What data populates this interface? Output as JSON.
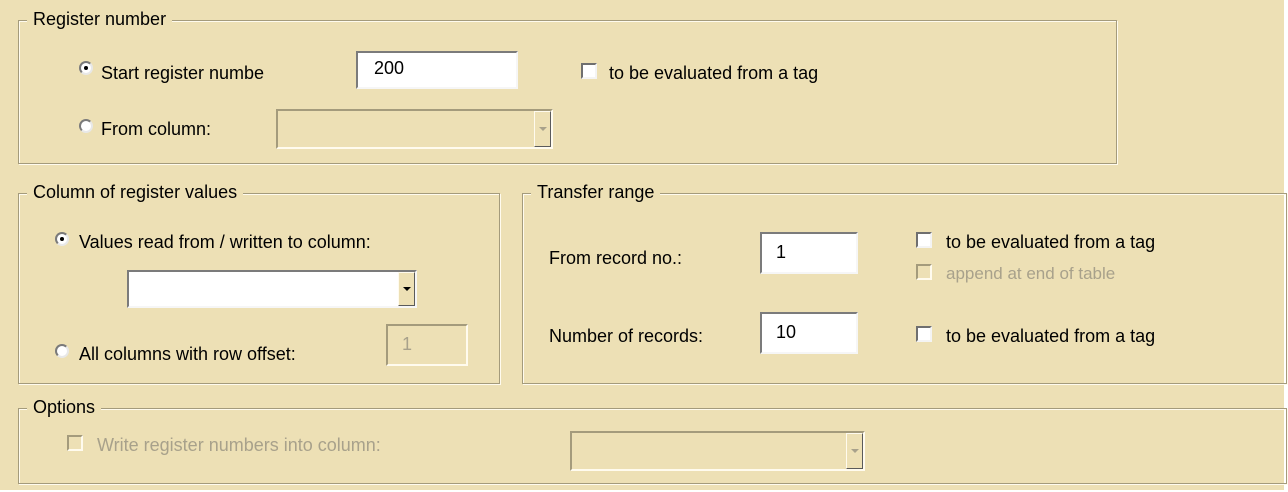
{
  "register_number": {
    "title": "Register number",
    "start_register_label": "Start register numbe",
    "start_register_value": "200",
    "start_register_checked": true,
    "eval_tag_label": "to be evaluated from a tag",
    "from_column_label": "From column:",
    "from_column_value": ""
  },
  "column_values": {
    "title": "Column of register values",
    "values_rw_label": "Values read from / written to column:",
    "values_rw_checked": true,
    "column_value": "",
    "all_columns_label": "All columns with row offset:",
    "row_offset_value": "1"
  },
  "transfer_range": {
    "title": "Transfer range",
    "from_record_label": "From record no.:",
    "from_record_value": "1",
    "from_record_eval_label": "to be evaluated from a tag",
    "append_label": "append at end of table",
    "num_records_label": "Number of records:",
    "num_records_value": "10",
    "num_records_eval_label": "to be evaluated from a tag"
  },
  "options": {
    "title": "Options",
    "write_numbers_label": "Write register numbers into column:",
    "write_numbers_column_value": ""
  }
}
